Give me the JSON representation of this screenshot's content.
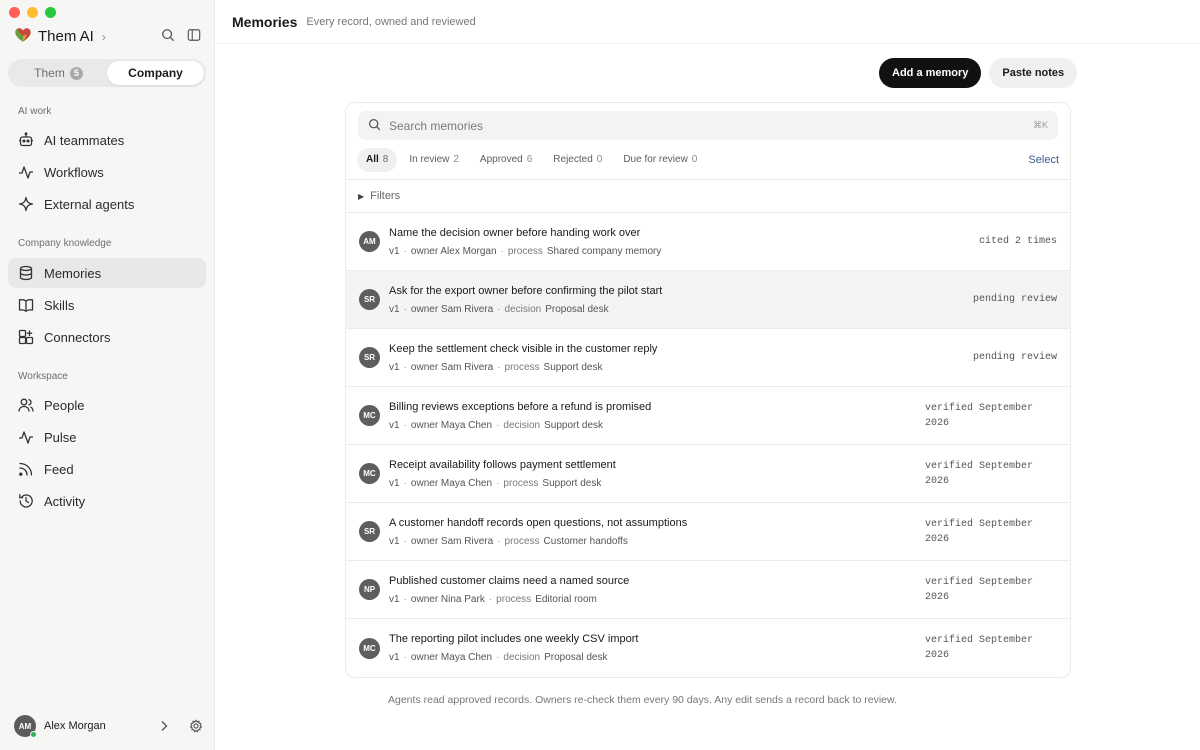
{
  "window": {
    "controls": [
      "close",
      "minimize",
      "maximize"
    ]
  },
  "sidebar": {
    "brand": {
      "name": "Them AI",
      "logo_icon": "heart-logo-icon"
    },
    "segment": [
      {
        "label": "Them",
        "badge": "5",
        "active": false
      },
      {
        "label": "Company",
        "badge": "",
        "active": true
      }
    ],
    "sections": [
      {
        "label": "AI work",
        "items": [
          {
            "label": "AI teammates",
            "icon": "robot-icon"
          },
          {
            "label": "Workflows",
            "icon": "pulse-icon"
          },
          {
            "label": "External agents",
            "icon": "sparkle-icon"
          }
        ]
      },
      {
        "label": "Company knowledge",
        "items": [
          {
            "label": "Memories",
            "icon": "database-icon",
            "active": true
          },
          {
            "label": "Skills",
            "icon": "book-icon"
          },
          {
            "label": "Connectors",
            "icon": "grid-plus-icon"
          }
        ]
      },
      {
        "label": "Workspace",
        "items": [
          {
            "label": "People",
            "icon": "people-icon"
          },
          {
            "label": "Pulse",
            "icon": "pulse-icon"
          },
          {
            "label": "Feed",
            "icon": "rss-icon"
          },
          {
            "label": "Activity",
            "icon": "history-icon"
          }
        ]
      }
    ],
    "user": {
      "initials": "AM",
      "name": "Alex Morgan"
    }
  },
  "header": {
    "title": "Memories",
    "subtitle": "Every record, owned and reviewed"
  },
  "toolbar": {
    "add_label": "Add a memory",
    "paste_label": "Paste notes"
  },
  "search": {
    "placeholder": "Search memories",
    "shortcut": "⌘K"
  },
  "tabs": [
    {
      "label": "All",
      "count": "8",
      "active": true
    },
    {
      "label": "In review",
      "count": "2"
    },
    {
      "label": "Approved",
      "count": "6"
    },
    {
      "label": "Rejected",
      "count": "0"
    },
    {
      "label": "Due for review",
      "count": "0"
    }
  ],
  "select_label": "Select",
  "filters_label": "Filters",
  "memories": [
    {
      "initials": "AM",
      "title": "Name the decision owner before handing work over",
      "version": "v1",
      "owner": "owner Alex Morgan",
      "kind": "process",
      "place": "Shared company memory",
      "status": "cited 2 times"
    },
    {
      "initials": "SR",
      "title": "Ask for the export owner before confirming the pilot start",
      "version": "v1",
      "owner": "owner Sam Rivera",
      "kind": "decision",
      "place": "Proposal desk",
      "status": "pending review",
      "hover": true
    },
    {
      "initials": "SR",
      "title": "Keep the settlement check visible in the customer reply",
      "version": "v1",
      "owner": "owner Sam Rivera",
      "kind": "process",
      "place": "Support desk",
      "status": "pending review"
    },
    {
      "initials": "MC",
      "title": "Billing reviews exceptions before a refund is promised",
      "version": "v1",
      "owner": "owner Maya Chen",
      "kind": "decision",
      "place": "Support desk",
      "status": "verified September 2026"
    },
    {
      "initials": "MC",
      "title": "Receipt availability follows payment settlement",
      "version": "v1",
      "owner": "owner Maya Chen",
      "kind": "process",
      "place": "Support desk",
      "status": "verified September 2026"
    },
    {
      "initials": "SR",
      "title": "A customer handoff records open questions, not assumptions",
      "version": "v1",
      "owner": "owner Sam Rivera",
      "kind": "process",
      "place": "Customer handoffs",
      "status": "verified September 2026"
    },
    {
      "initials": "NP",
      "title": "Published customer claims need a named source",
      "version": "v1",
      "owner": "owner Nina Park",
      "kind": "process",
      "place": "Editorial room",
      "status": "verified September 2026"
    },
    {
      "initials": "MC",
      "title": "The reporting pilot includes one weekly CSV import",
      "version": "v1",
      "owner": "owner Maya Chen",
      "kind": "decision",
      "place": "Proposal desk",
      "status": "verified September 2026"
    }
  ],
  "footer_note": "Agents read approved records. Owners re-check them every 90 days. Any edit sends a record back to review."
}
